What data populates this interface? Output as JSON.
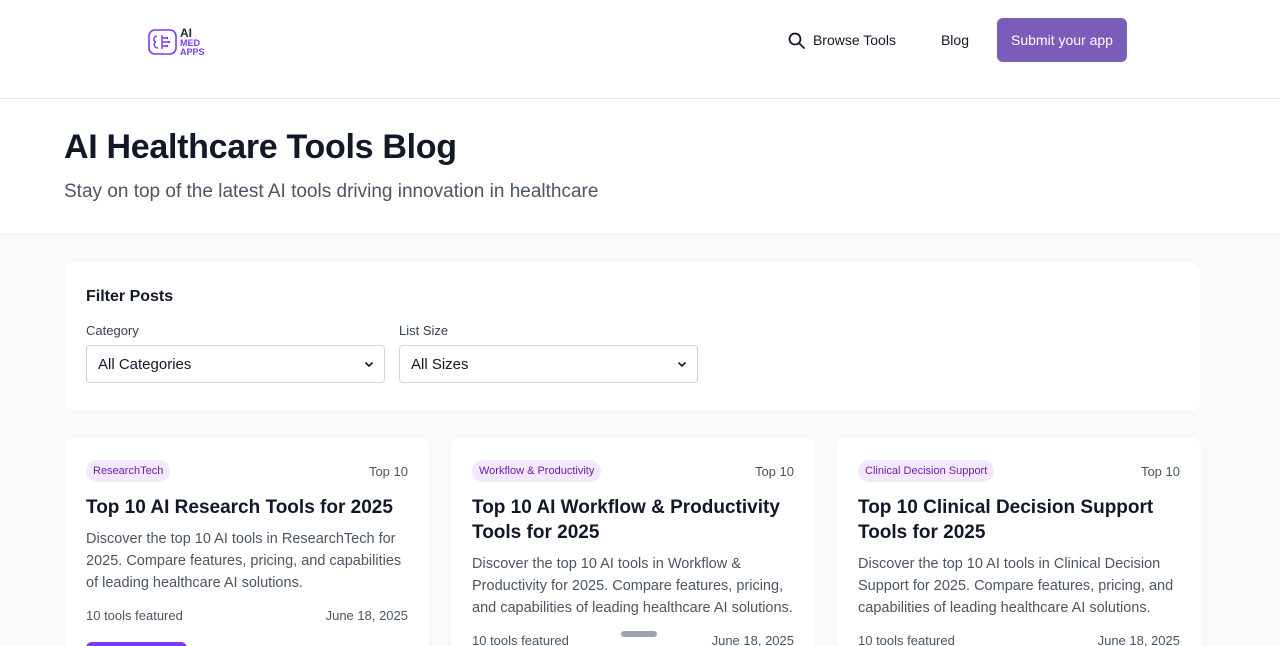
{
  "header": {
    "logo": {
      "line1": "AI",
      "line2": "MED",
      "line3": "APPS"
    },
    "nav": {
      "browse_label": "Browse Tools",
      "blog_label": "Blog",
      "submit_label": "Submit your app"
    }
  },
  "hero": {
    "title": "AI Healthcare Tools Blog",
    "subtitle": "Stay on top of the latest AI tools driving innovation in healthcare"
  },
  "filters": {
    "title": "Filter Posts",
    "category": {
      "label": "Category",
      "value": "All Categories"
    },
    "list_size": {
      "label": "List Size",
      "value": "All Sizes"
    }
  },
  "cards": [
    {
      "badge": "ResearchTech",
      "list_size": "Top 10",
      "title": "Top 10 AI Research Tools for 2025",
      "description": "Discover the top 10 AI tools in ResearchTech for 2025. Compare features, pricing, and capabilities of leading healthcare AI solutions.",
      "tools_featured": "10 tools featured",
      "date": "June 18, 2025"
    },
    {
      "badge": "Workflow & Productivity",
      "list_size": "Top 10",
      "title": "Top 10 AI Workflow & Productivity Tools for 2025",
      "description": "Discover the top 10 AI tools in Workflow & Productivity for 2025. Compare features, pricing, and capabilities of leading healthcare AI solutions.",
      "tools_featured": "10 tools featured",
      "date": "June 18, 2025"
    },
    {
      "badge": "Clinical Decision Support",
      "list_size": "Top 10",
      "title": "Top 10 Clinical Decision Support Tools for 2025",
      "description": "Discover the top 10 AI tools in Clinical Decision Support for 2025. Compare features, pricing, and capabilities of leading healthcare AI solutions.",
      "tools_featured": "10 tools featured",
      "date": "June 18, 2025"
    }
  ],
  "colors": {
    "accent": "#7b5cb8",
    "badge_bg": "#f3e8ff",
    "badge_text": "#6b21a8"
  },
  "icons": {
    "search": "search-icon",
    "select_arrow": "chevron-down-icon"
  }
}
